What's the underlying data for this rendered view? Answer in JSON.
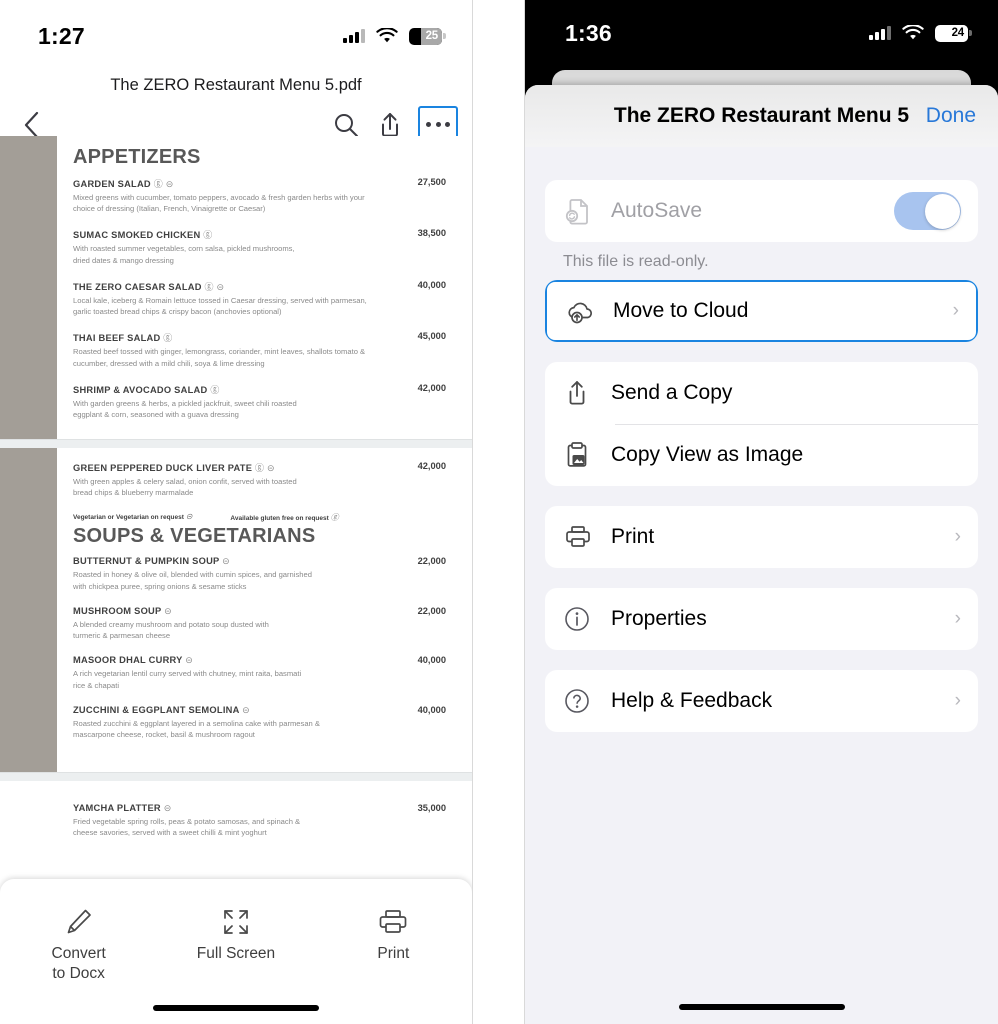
{
  "left_phone": {
    "status_bar": {
      "time": "1:27",
      "battery_percent": "25",
      "signal_icon": "cellular-bars-icon",
      "wifi_icon": "wifi-icon",
      "battery_icon": "battery-icon"
    },
    "document_title": "The ZERO Restaurant Menu 5.pdf",
    "toolbar": {
      "back_icon": "chevron-left-icon",
      "search_icon": "search-icon",
      "share_icon": "share-icon",
      "more_icon": "more-options-icon"
    },
    "pdf": {
      "pages": [
        {
          "section_title": "APPETIZERS",
          "has_sideband": true,
          "items": [
            {
              "name": "GARDEN SALAD",
              "symbols": "ⓖ ⊝",
              "price": "27,500",
              "desc": "Mixed greens with cucumber, tomato peppers, avocado & fresh garden herbs with your choice of dressing (Italian, French, Vinaigrette or Caesar)"
            },
            {
              "name": "SUMAC SMOKED CHICKEN",
              "symbols": "ⓖ",
              "price": "38,500",
              "desc": "With roasted summer vegetables, corn salsa, pickled mushrooms, dried dates & mango dressing"
            },
            {
              "name": "THE ZERO CAESAR SALAD",
              "symbols": "ⓖ ⊝",
              "price": "40,000",
              "desc": "Local kale, iceberg & Romain lettuce tossed in Caesar dressing, served with parmesan, garlic toasted bread chips & crispy bacon (anchovies optional)"
            },
            {
              "name": "THAI BEEF SALAD",
              "symbols": "ⓖ",
              "price": "45,000",
              "desc": "Roasted beef tossed with ginger, lemongrass, coriander, mint leaves, shallots tomato & cucumber, dressed with a mild chili, soya & lime dressing"
            },
            {
              "name": "SHRIMP & AVOCADO SALAD",
              "symbols": "ⓖ",
              "price": "42,000",
              "desc": "With garden greens & herbs, a pickled jackfruit, sweet chili roasted eggplant & corn, seasoned with a guava dressing"
            }
          ]
        },
        {
          "section_title": "SOUPS & VEGETARIANS",
          "has_sideband": true,
          "legend": [
            {
              "text": "Vegetarian or Vegetarian on request",
              "symbol": "⊝"
            },
            {
              "text": "Available gluten free on request",
              "symbol": "ⓖ"
            }
          ],
          "pre_items": [
            {
              "name": "GREEN PEPPERED DUCK LIVER PATE",
              "symbols": "ⓖ ⊝",
              "price": "42,000",
              "desc": "With green apples & celery salad, onion confit, served with toasted bread chips & blueberry marmalade"
            }
          ],
          "items": [
            {
              "name": "BUTTERNUT & PUMPKIN SOUP",
              "symbols": "⊝",
              "price": "22,000",
              "desc": "Roasted in honey & olive oil, blended with cumin spices, and garnished with chickpea puree, spring onions & sesame sticks"
            },
            {
              "name": "MUSHROOM SOUP",
              "symbols": "⊝",
              "price": "22,000",
              "desc": "A blended creamy mushroom and potato soup dusted with turmeric & parmesan cheese"
            },
            {
              "name": "MASOOR DHAL CURRY",
              "symbols": "⊝",
              "price": "40,000",
              "desc": "A rich vegetarian lentil curry served with chutney, mint raita, basmati rice & chapati"
            },
            {
              "name": "ZUCCHINI & EGGPLANT SEMOLINA",
              "symbols": "⊝",
              "price": "40,000",
              "desc": "Roasted zucchini & eggplant layered in a semolina cake with parmesan & mascarpone cheese, rocket, basil & mushroom ragout"
            }
          ]
        },
        {
          "section_title": "",
          "has_sideband": false,
          "items": [
            {
              "name": "YAMCHA PLATTER",
              "symbols": "⊝",
              "price": "35,000",
              "desc": "Fried vegetable spring rolls, peas & potato samosas, and spinach & cheese savories, served with a sweet chilli & mint yoghurt"
            }
          ]
        }
      ]
    },
    "bottom_toolbar": [
      {
        "label": "Convert\nto Docx",
        "label_line1": "Convert",
        "label_line2": "to Docx",
        "icon": "pencil-icon"
      },
      {
        "label": "Full Screen",
        "label_line1": "Full Screen",
        "label_line2": "",
        "icon": "full-screen-icon"
      },
      {
        "label": "Print",
        "label_line1": "Print",
        "label_line2": "",
        "icon": "printer-icon"
      }
    ]
  },
  "right_phone": {
    "status_bar": {
      "time": "1:36",
      "battery_percent": "24",
      "signal_icon": "cellular-bars-icon",
      "wifi_icon": "wifi-icon",
      "battery_icon": "battery-icon"
    },
    "sheet": {
      "title": "The ZERO Restaurant Menu 5",
      "done_label": "Done",
      "autosave": {
        "label": "AutoSave",
        "icon": "autosave-document-icon",
        "state": "on",
        "disabled": true
      },
      "readonly_note": "This file is read-only.",
      "groups": [
        {
          "rows": [
            {
              "label": "Move to Cloud",
              "icon": "cloud-upload-icon",
              "chevron": true,
              "highlighted": true
            }
          ]
        },
        {
          "rows": [
            {
              "label": "Send a Copy",
              "icon": "share-icon",
              "chevron": false,
              "highlighted": false
            },
            {
              "label": "Copy View as Image",
              "icon": "clipboard-image-icon",
              "chevron": false,
              "highlighted": false
            }
          ]
        },
        {
          "rows": [
            {
              "label": "Print",
              "icon": "printer-icon",
              "chevron": true,
              "highlighted": false
            }
          ]
        },
        {
          "rows": [
            {
              "label": "Properties",
              "icon": "info-circle-icon",
              "chevron": true,
              "highlighted": false
            }
          ]
        },
        {
          "rows": [
            {
              "label": "Help & Feedback",
              "icon": "question-circle-icon",
              "chevron": true,
              "highlighted": false
            }
          ]
        }
      ]
    }
  },
  "colors": {
    "accent_blue": "#1a84e0",
    "link_blue": "#2878d8",
    "toggle_blue": "#a8c4ef",
    "sheet_bg": "#f2f2f7",
    "pdf_sideband": "#a39e97",
    "menu_heading": "#585858"
  }
}
